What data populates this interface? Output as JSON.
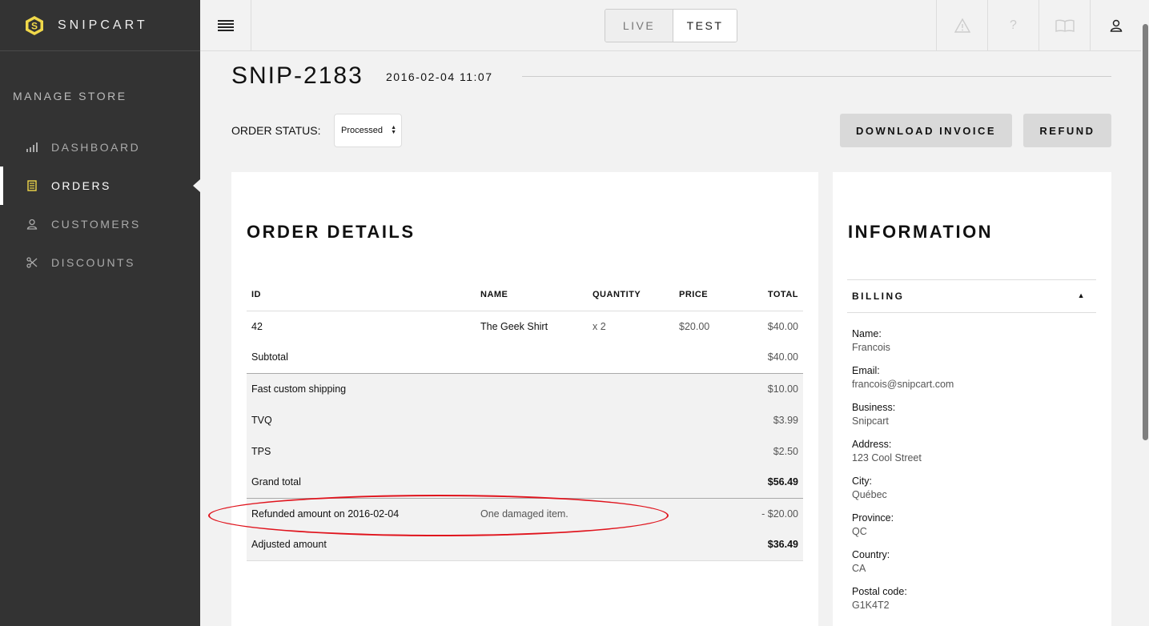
{
  "brand": {
    "name": "SNIPCART",
    "accent": "#f0d84a"
  },
  "sidebar": {
    "section_title": "MANAGE STORE",
    "items": [
      {
        "label": "DASHBOARD",
        "icon": "bar-chart-icon"
      },
      {
        "label": "ORDERS",
        "icon": "receipt-icon",
        "active": true
      },
      {
        "label": "CUSTOMERS",
        "icon": "user-icon"
      },
      {
        "label": "DISCOUNTS",
        "icon": "scissors-icon"
      }
    ]
  },
  "topbar": {
    "env": {
      "live": "LIVE",
      "test": "TEST",
      "selected": "TEST"
    },
    "icons": [
      "warning-icon",
      "help-icon",
      "book-icon",
      "user-icon"
    ]
  },
  "order": {
    "number": "SNIP-2183",
    "date": "2016-02-04 11:07",
    "status_label": "ORDER STATUS:",
    "status_value": "Processed",
    "download_label": "DOWNLOAD INVOICE",
    "refund_label": "REFUND"
  },
  "details": {
    "title": "ORDER DETAILS",
    "headers": {
      "id": "ID",
      "name": "NAME",
      "quantity": "QUANTITY",
      "price": "PRICE",
      "total": "TOTAL"
    },
    "item": {
      "id": "42",
      "name": "The Geek Shirt",
      "quantity": "x 2",
      "price": "$20.00",
      "total": "$40.00"
    },
    "subtotal": {
      "label": "Subtotal",
      "value": "$40.00"
    },
    "shipping": {
      "label": "Fast custom shipping",
      "value": "$10.00"
    },
    "tvq": {
      "label": "TVQ",
      "value": "$3.99"
    },
    "tps": {
      "label": "TPS",
      "value": "$2.50"
    },
    "grand_total": {
      "label": "Grand total",
      "value": "$56.49"
    },
    "refund": {
      "label": "Refunded amount on 2016-02-04",
      "note": "One damaged item.",
      "value": "- $20.00"
    },
    "adjusted": {
      "label": "Adjusted amount",
      "value": "$36.49"
    },
    "highlight_color": "#e0141d"
  },
  "information": {
    "title": "INFORMATION",
    "billing_title": "BILLING",
    "fields": [
      {
        "key": "Name:",
        "value": "Francois"
      },
      {
        "key": "Email:",
        "value": "francois@snipcart.com"
      },
      {
        "key": "Business:",
        "value": "Snipcart"
      },
      {
        "key": "Address:",
        "value": "123 Cool Street"
      },
      {
        "key": "City:",
        "value": "Québec"
      },
      {
        "key": "Province:",
        "value": "QC"
      },
      {
        "key": "Country:",
        "value": "CA"
      },
      {
        "key": "Postal code:",
        "value": "G1K4T2"
      }
    ]
  }
}
